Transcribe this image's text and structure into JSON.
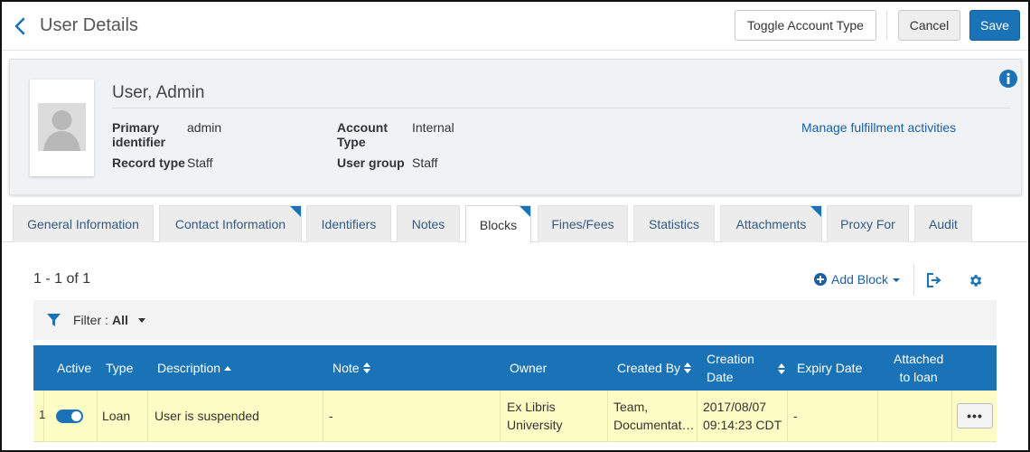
{
  "header": {
    "title": "User Details",
    "toggle_label": "Toggle Account Type",
    "cancel_label": "Cancel",
    "save_label": "Save"
  },
  "profile": {
    "name": "User, Admin",
    "fields": {
      "primary_identifier_label_1": "Primary",
      "primary_identifier_label_2": "identifier",
      "primary_identifier_value": "admin",
      "account_type_label_1": "Account",
      "account_type_label_2": "Type",
      "account_type_value": "Internal",
      "record_type_label": "Record type",
      "record_type_value": "Staff",
      "user_group_label": "User group",
      "user_group_value": "Staff"
    },
    "manage_link": "Manage fulfillment activities"
  },
  "tabs": [
    {
      "label": "General Information",
      "active": false,
      "flag": false
    },
    {
      "label": "Contact Information",
      "active": false,
      "flag": true
    },
    {
      "label": "Identifiers",
      "active": false,
      "flag": false
    },
    {
      "label": "Notes",
      "active": false,
      "flag": false
    },
    {
      "label": "Blocks",
      "active": true,
      "flag": true
    },
    {
      "label": "Fines/Fees",
      "active": false,
      "flag": false
    },
    {
      "label": "Statistics",
      "active": false,
      "flag": false
    },
    {
      "label": "Attachments",
      "active": false,
      "flag": true
    },
    {
      "label": "Proxy For",
      "active": false,
      "flag": false
    },
    {
      "label": "Audit",
      "active": false,
      "flag": false
    }
  ],
  "list": {
    "count": "1 - 1 of 1",
    "add_block_label": "Add Block",
    "filter_label": "Filter :",
    "filter_value": "All",
    "columns": {
      "active": "Active",
      "type": "Type",
      "description": "Description",
      "note": "Note",
      "owner": "Owner",
      "created_by": "Created By",
      "creation_date_1": "Creation",
      "creation_date_2": "Date",
      "expiry_date": "Expiry Date",
      "attached_1": "Attached",
      "attached_2": "to loan"
    },
    "rows": [
      {
        "num": "1",
        "active": true,
        "type": "Loan",
        "description": "User is suspended",
        "note": "-",
        "owner_1": "Ex Libris",
        "owner_2": "University",
        "created_by_1": "Team,",
        "created_by_2": "Documentat…",
        "creation_date_1": "2017/08/07",
        "creation_date_2": "09:14:23 CDT",
        "expiry_date": "-",
        "attached": "",
        "more_label": "•••"
      }
    ]
  },
  "colors": {
    "primary": "#1a73b6",
    "link": "#1a5fa3",
    "row_highlight": "#fcfcc4",
    "profile_bg": "#f0f3f5"
  },
  "icons": [
    "chevron-left-icon",
    "avatar-placeholder",
    "info-icon",
    "plus-circle-icon",
    "export-icon",
    "gear-icon",
    "filter-icon",
    "sort-icon",
    "ellipsis-icon"
  ]
}
